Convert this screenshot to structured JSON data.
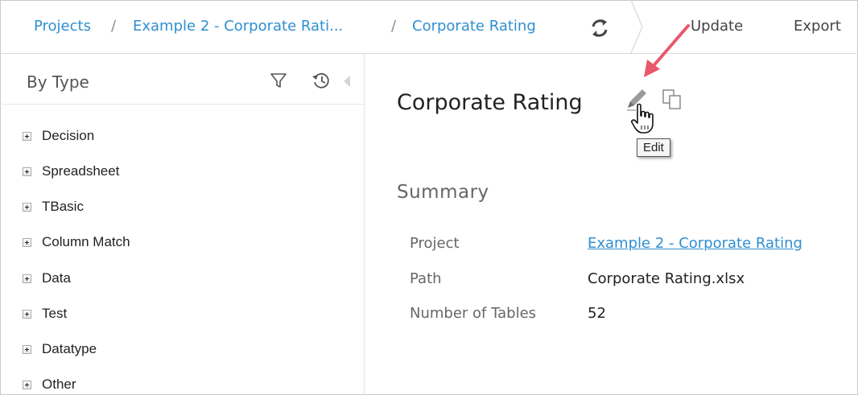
{
  "breadcrumb": {
    "items": [
      "Projects",
      "Example 2 - Corporate Rati...",
      "Corporate Rating"
    ],
    "separator": "/"
  },
  "toolbar": {
    "refresh_icon": "refresh-icon",
    "update_label": "Update",
    "export_label": "Export"
  },
  "sidebar": {
    "title": "By Type",
    "icons": [
      "filter-icon",
      "history-icon",
      "collapse-left-icon"
    ],
    "items": [
      {
        "label": "Decision"
      },
      {
        "label": "Spreadsheet"
      },
      {
        "label": "TBasic"
      },
      {
        "label": "Column Match"
      },
      {
        "label": "Data"
      },
      {
        "label": "Test"
      },
      {
        "label": "Datatype"
      },
      {
        "label": "Other"
      }
    ]
  },
  "main": {
    "title": "Corporate Rating",
    "tooltip": "Edit",
    "summary": {
      "heading": "Summary",
      "rows": [
        {
          "label": "Project",
          "value": "Example 2 - Corporate Rating"
        },
        {
          "label": "Path",
          "value": "Corporate Rating.xlsx"
        },
        {
          "label": "Number of Tables",
          "value": "52"
        }
      ]
    }
  },
  "colors": {
    "link": "#2f8fd0",
    "annotation_arrow": "#e8596b"
  }
}
